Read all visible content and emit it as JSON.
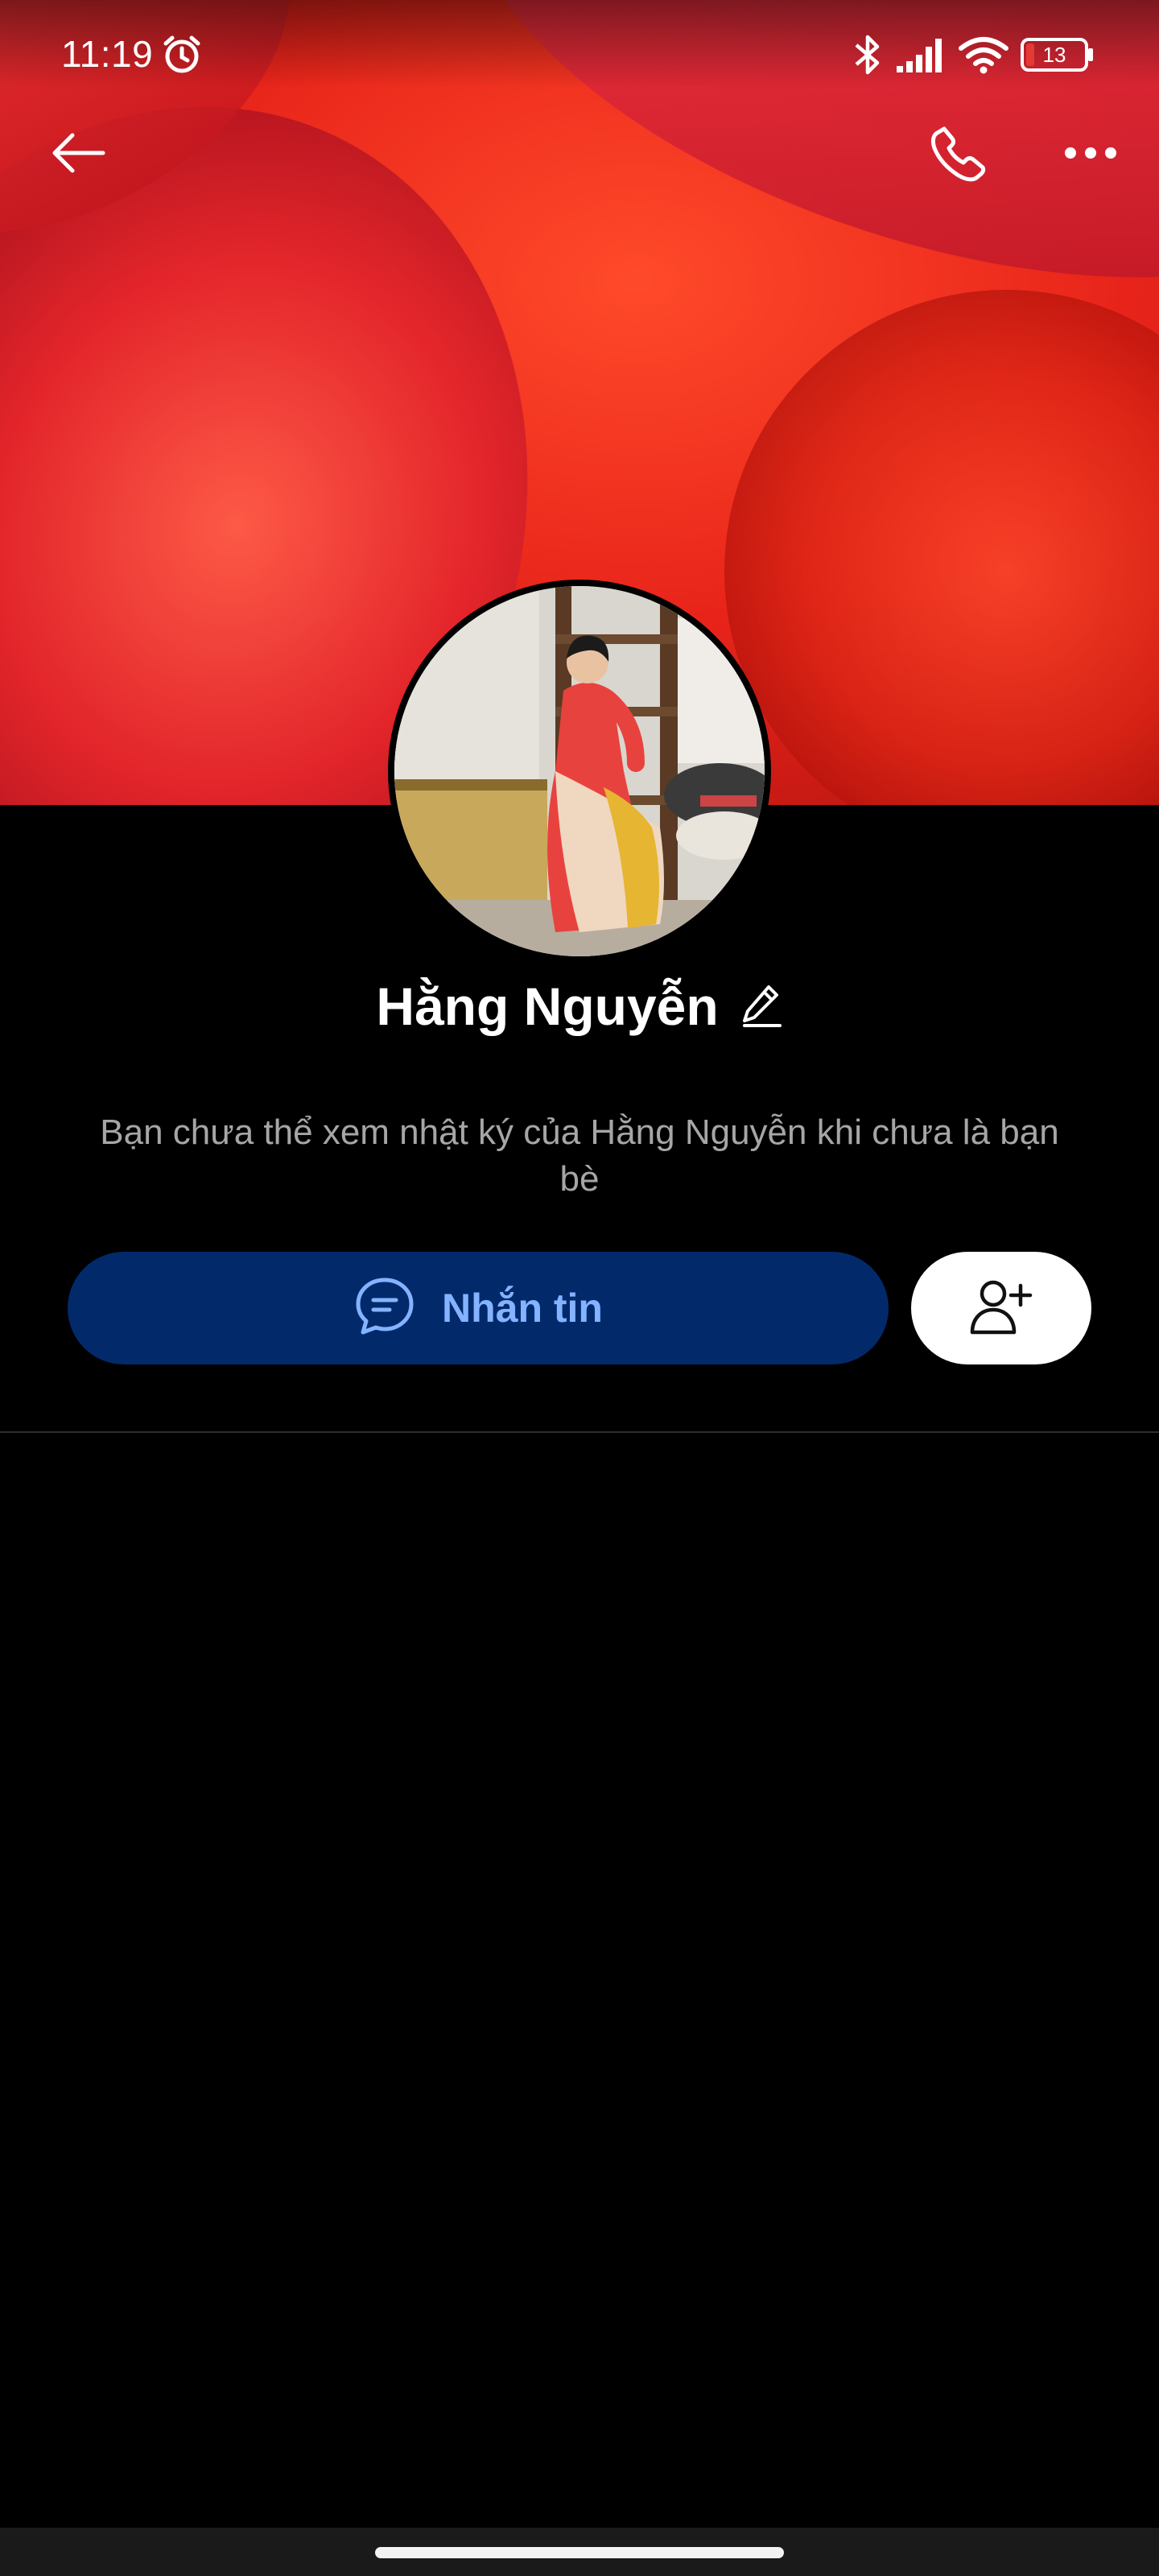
{
  "status_bar": {
    "time": "11:19",
    "battery_level": "13",
    "icons": [
      "alarm-icon",
      "bluetooth-icon",
      "signal-icon",
      "wifi-icon",
      "battery-icon"
    ]
  },
  "top_nav": {
    "back_icon": "back-arrow-icon",
    "call_icon": "phone-icon",
    "more_icon": "more-horizontal-icon"
  },
  "profile": {
    "name": "Hằng Nguyễn",
    "edit_icon": "pencil-icon",
    "privacy_notice": "Bạn chưa thể xem nhật ký của Hằng Nguyễn khi chưa là bạn bè"
  },
  "actions": {
    "message_label": "Nhắn tin",
    "message_icon": "chat-bubble-icon",
    "add_friend_icon": "add-user-icon"
  },
  "colors": {
    "background": "#000000",
    "message_button_bg": "#022a6b",
    "message_button_text": "#84b3ff",
    "notice_text": "#a6a6a6",
    "add_friend_bg": "#ffffff"
  }
}
